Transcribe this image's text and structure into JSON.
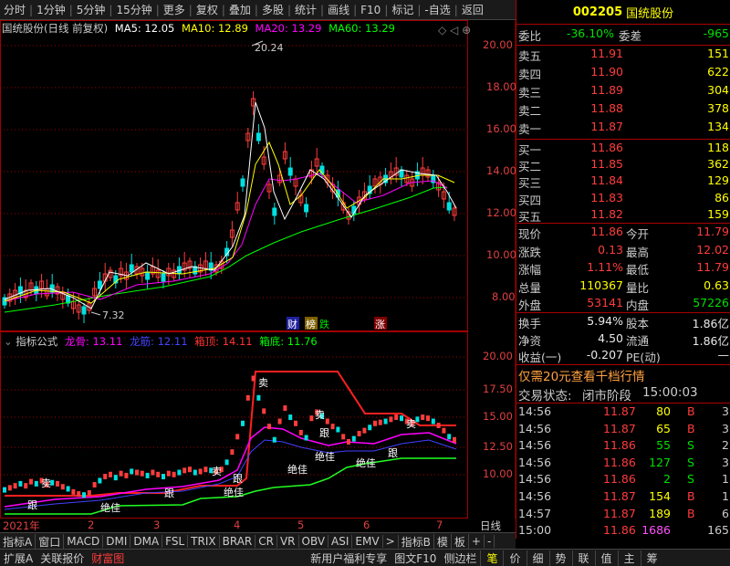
{
  "toolbar": {
    "items": [
      "分时",
      "1分钟",
      "5分钟",
      "15分钟",
      "更多",
      "复权",
      "叠加",
      "多股",
      "统计",
      "画线",
      "F10",
      "标记",
      "-自选",
      "返回"
    ]
  },
  "stock": {
    "code": "002205",
    "name": "国统股份"
  },
  "main_chart": {
    "title": "国统股份(日线 前复权)",
    "ma5": "MA5: 12.05",
    "ma10": "MA10: 12.89",
    "ma20": "MA20: 13.29",
    "ma60": "MA60: 13.29",
    "y_labels": [
      "20.00",
      "18.00",
      "16.00",
      "14.00",
      "12.00",
      "10.00",
      "8.00"
    ],
    "high_label": "20.24",
    "low_label": "7.32",
    "tags": {
      "cai": "财",
      "bang": "榜",
      "die": "跌",
      "zhang": "涨"
    }
  },
  "indicator": {
    "title": "指标公式",
    "longgu": "龙骨: 13.11",
    "longjin": "龙筋: 12.11",
    "xiangding": "箱顶: 14.11",
    "xiangdi": "箱底: 11.76",
    "y_labels": [
      "20.00",
      "17.50",
      "15.00",
      "12.50",
      "10.00"
    ],
    "marks": {
      "mai": "卖",
      "gen": "跟",
      "jue": "绝佳",
      "jiaru": "加入"
    }
  },
  "date_axis": {
    "items": [
      "2021年",
      "2",
      "3",
      "4",
      "5",
      "6",
      "7"
    ],
    "period": "日线"
  },
  "quote": {
    "weibi_label": "委比",
    "weibi": "-36.10%",
    "weicha_label": "委差",
    "weicha": "-965",
    "sells": [
      {
        "label": "卖五",
        "price": "11.91",
        "vol": "151"
      },
      {
        "label": "卖四",
        "price": "11.90",
        "vol": "622"
      },
      {
        "label": "卖三",
        "price": "11.89",
        "vol": "304"
      },
      {
        "label": "卖二",
        "price": "11.88",
        "vol": "378"
      },
      {
        "label": "卖一",
        "price": "11.87",
        "vol": "134"
      }
    ],
    "buys": [
      {
        "label": "买一",
        "price": "11.86",
        "vol": "118"
      },
      {
        "label": "买二",
        "price": "11.85",
        "vol": "362"
      },
      {
        "label": "买三",
        "price": "11.84",
        "vol": "129"
      },
      {
        "label": "买四",
        "price": "11.83",
        "vol": "86"
      },
      {
        "label": "买五",
        "price": "11.82",
        "vol": "159"
      }
    ],
    "stats": [
      {
        "l1": "现价",
        "v1": "11.86",
        "l2": "今开",
        "v2": "11.79"
      },
      {
        "l1": "涨跌",
        "v1": "0.13",
        "l2": "最高",
        "v2": "12.02"
      },
      {
        "l1": "涨幅",
        "v1": "1.11%",
        "l2": "最低",
        "v2": "11.79"
      },
      {
        "l1": "总量",
        "v1": "110367",
        "l2": "量比",
        "v2": "0.63"
      },
      {
        "l1": "外盘",
        "v1": "53141",
        "l2": "内盘",
        "v2": "57226"
      }
    ],
    "stats2": [
      {
        "l1": "换手",
        "v1": "5.94%",
        "l2": "股本",
        "v2": "1.86亿"
      },
      {
        "l1": "净资",
        "v1": "4.50",
        "l2": "流通",
        "v2": "1.86亿"
      },
      {
        "l1": "收益(一)",
        "v1": "-0.207",
        "l2": "PE(动)",
        "v2": "—"
      }
    ],
    "promo": "仅需20元查看千档行情",
    "status_label": "交易状态:",
    "status": "闭市阶段",
    "status_time": "15:00:03",
    "ticks": [
      {
        "t": "14:56",
        "p": "11.87",
        "q": "80",
        "f": "B",
        "n": "3"
      },
      {
        "t": "14:56",
        "p": "11.87",
        "q": "65",
        "f": "B",
        "n": "3"
      },
      {
        "t": "14:56",
        "p": "11.86",
        "q": "55",
        "f": "S",
        "n": "2"
      },
      {
        "t": "14:56",
        "p": "11.86",
        "q": "127",
        "f": "S",
        "n": "3"
      },
      {
        "t": "14:56",
        "p": "11.86",
        "q": "2",
        "f": "S",
        "n": "1"
      },
      {
        "t": "14:56",
        "p": "11.87",
        "q": "154",
        "f": "B",
        "n": "1"
      },
      {
        "t": "14:57",
        "p": "11.87",
        "q": "189",
        "f": "B",
        "n": "6"
      },
      {
        "t": "15:00",
        "p": "11.86",
        "q": "1686",
        "f": "",
        "n": "165"
      }
    ]
  },
  "bottom_tabs": [
    "指标A",
    "窗口",
    "MACD",
    "DMI",
    "DMA",
    "FSL",
    "TRIX",
    "BRAR",
    "CR",
    "VR",
    "OBV",
    "ASI",
    "EMV",
    ">",
    "指标B",
    "模",
    "板",
    "+",
    "-"
  ],
  "footer": {
    "left": [
      "扩展A",
      "关联报价",
      "财富图"
    ],
    "ad": "新用户福利专享",
    "right1": "图文F10",
    "right2": "侧边栏",
    "right_tabs": [
      "笔",
      "价",
      "细",
      "势",
      "联",
      "值",
      "主",
      "筹"
    ]
  },
  "colors": {
    "up": "#ff3c3c",
    "down": "#00e000",
    "ma5": "#ffffff",
    "ma10": "#ffff00",
    "ma20": "#ff00ff",
    "ma60": "#00ff00",
    "axis": "#a00000"
  }
}
